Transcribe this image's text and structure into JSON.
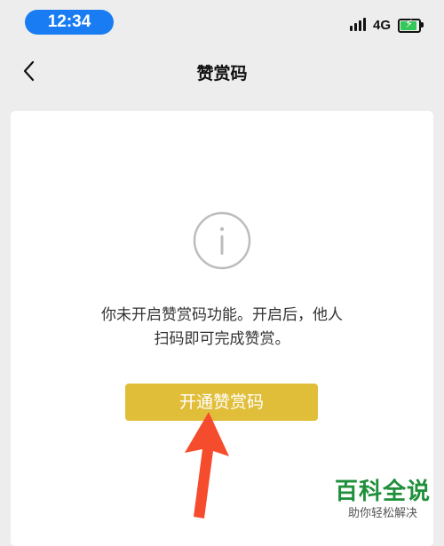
{
  "status_bar": {
    "time": "12:34",
    "network": "4G",
    "time_pill_color": "#1a7cf2",
    "battery_color": "#34c759"
  },
  "nav": {
    "title": "赞赏码",
    "back_icon": "chevron-left-icon"
  },
  "card": {
    "icon": "info-circle-icon",
    "message_line1": "你未开启赞赏码功能。开启后，他人",
    "message_line2": "扫码即可完成赞赏。",
    "button_label": "开通赞赏码",
    "button_color": "#e1be39"
  },
  "annotation": {
    "arrow_icon": "red-arrow-up-icon",
    "arrow_color": "#f44c2c"
  },
  "watermark": {
    "title": "百科全说",
    "subtitle": "助你轻松解决",
    "color": "#1f8f3a"
  }
}
